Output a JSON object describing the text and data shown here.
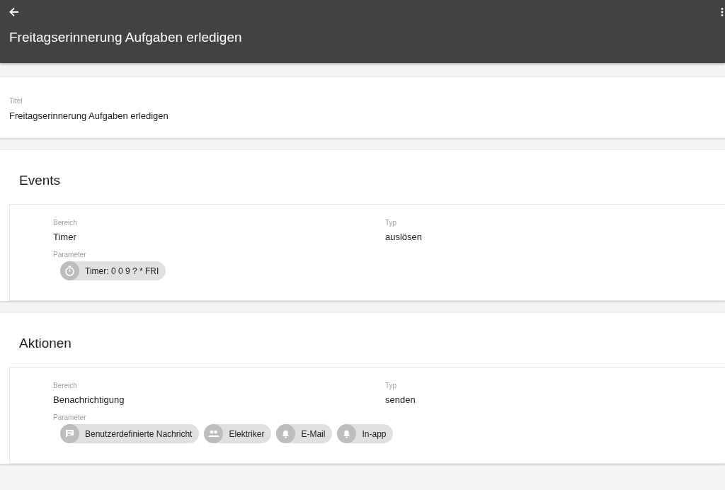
{
  "app_bar": {
    "title": "Freitagserinnerung Aufgaben erledigen"
  },
  "title_field": {
    "label": "Titel",
    "value": "Freitagserinnerung Aufgaben erledigen"
  },
  "sections": [
    {
      "heading": "Events",
      "area_label": "Bereich",
      "area": "Timer",
      "type_label": "Typ",
      "type": "auslösen",
      "params_label": "Parameter",
      "chips": [
        {
          "kind": "timer",
          "label": "Timer: 0 0 9 ? * FRI"
        }
      ]
    },
    {
      "heading": "Aktionen",
      "area_label": "Bereich",
      "area": "Benachrichtigung",
      "type_label": "Typ",
      "type": "senden",
      "params_label": "Parameter",
      "chips": [
        {
          "kind": "message",
          "label": "Benutzerdefinierte Nachricht"
        },
        {
          "kind": "group",
          "label": "Elektriker"
        },
        {
          "kind": "bell",
          "label": "E-Mail"
        },
        {
          "kind": "bell",
          "label": "In-app"
        }
      ]
    }
  ]
}
